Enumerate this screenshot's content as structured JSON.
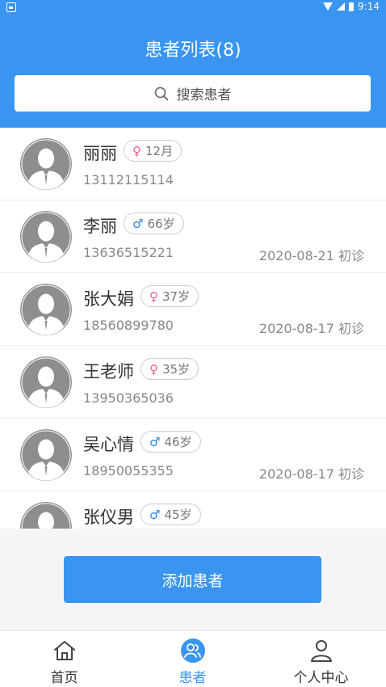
{
  "status_bar": {
    "time": "9:14"
  },
  "header": {
    "title": "患者列表(8)"
  },
  "search": {
    "placeholder": "搜索患者"
  },
  "patients": [
    {
      "name": "丽丽",
      "gender": "female",
      "gender_icon": "female-icon",
      "age": "12月",
      "phone": "13112115114",
      "visit": ""
    },
    {
      "name": "李丽",
      "gender": "male",
      "gender_icon": "male-icon",
      "age": "66岁",
      "phone": "13636515221",
      "visit": "2020-08-21 初诊"
    },
    {
      "name": "张大娟",
      "gender": "female",
      "gender_icon": "female-icon",
      "age": "37岁",
      "phone": "18560899780",
      "visit": "2020-08-17 初诊"
    },
    {
      "name": "王老师",
      "gender": "female",
      "gender_icon": "female-icon",
      "age": "35岁",
      "phone": "13950365036",
      "visit": ""
    },
    {
      "name": "吴心情",
      "gender": "male",
      "gender_icon": "male-icon",
      "age": "46岁",
      "phone": "18950055355",
      "visit": "2020-08-17 初诊"
    },
    {
      "name": "张仪男",
      "gender": "male",
      "gender_icon": "male-icon",
      "age": "45岁",
      "phone": "",
      "visit": ""
    }
  ],
  "add_button": {
    "label": "添加患者"
  },
  "tabbar": {
    "items": [
      {
        "label": "首页",
        "icon": "home-icon",
        "active": false
      },
      {
        "label": "患者",
        "icon": "patients-icon",
        "active": true
      },
      {
        "label": "个人中心",
        "icon": "person-icon",
        "active": false
      }
    ]
  },
  "colors": {
    "primary": "#3a95f0",
    "female": "#f06090",
    "male": "#2a86e8"
  }
}
